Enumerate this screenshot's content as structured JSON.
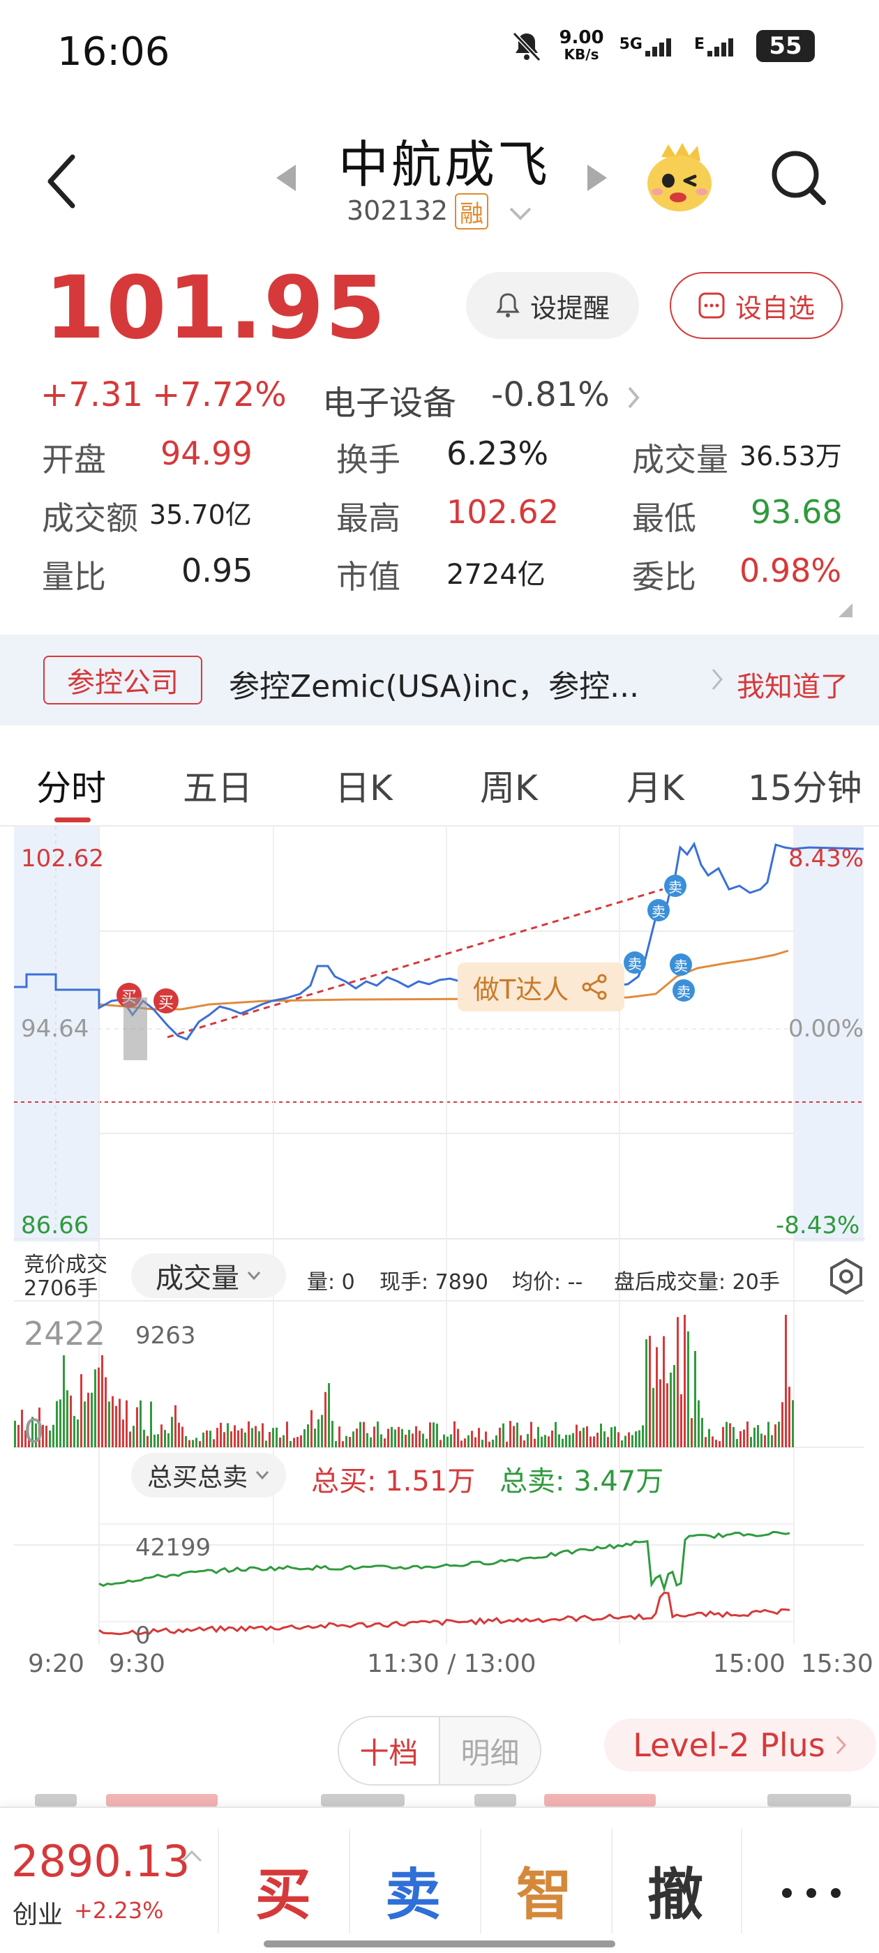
{
  "status_bar": {
    "time": "16:06",
    "speed_value": "9.00",
    "speed_unit": "KB/s",
    "net1": "5G",
    "net2": "E",
    "battery": "55"
  },
  "header": {
    "name": "中航成飞",
    "code": "302132",
    "badge": "融"
  },
  "quote": {
    "price": "101.95",
    "change": "+7.31",
    "change_pct": "+7.72%",
    "sector": "电子设备",
    "sector_pct": "-0.81%",
    "set_alert": "设提醒",
    "add_watch": "设自选"
  },
  "stats": [
    [
      {
        "label": "开盘",
        "value": "94.99",
        "color": "red"
      },
      {
        "label": "换手",
        "value": "6.23%",
        "color": "dark"
      },
      {
        "label": "成交量",
        "value": "36.53万",
        "color": "dark"
      }
    ],
    [
      {
        "label": "成交额",
        "value": "35.70亿",
        "color": "dark"
      },
      {
        "label": "最高",
        "value": "102.62",
        "color": "red"
      },
      {
        "label": "最低",
        "value": "93.68",
        "color": "green"
      }
    ],
    [
      {
        "label": "量比",
        "value": "0.95",
        "color": "dark"
      },
      {
        "label": "市值",
        "value": "2724亿",
        "color": "dark"
      },
      {
        "label": "委比",
        "value": "0.98%",
        "color": "red"
      }
    ]
  ],
  "banner": {
    "tag": "参控公司",
    "text": "参控Zemic(USA)inc，参控...",
    "dismiss": "我知道了"
  },
  "tabs": [
    "分时",
    "五日",
    "日K",
    "周K",
    "月K",
    "15分钟"
  ],
  "intraday": {
    "top_price": "102.62",
    "mid_price": "94.64",
    "bottom_price": "86.66",
    "top_pct": "8.43%",
    "mid_pct": "0.00%",
    "bottom_pct": "-8.43%",
    "buy_mark": "买",
    "sell_mark": "卖",
    "promo": "做T达人",
    "auction_label": "竞价成交",
    "auction_volume": "2706手",
    "volume_selector": "成交量",
    "vol_now": "量: 0",
    "hand_now": "现手: 7890",
    "avg_price": "均价: --",
    "after_volume": "盘后成交量: 20手",
    "vol_left_max": "2422",
    "vol_left_zero": "0",
    "vol_max": "9263",
    "total_selector": "总买总卖",
    "total_buy": "总买: 1.51万",
    "total_sell": "总卖: 3.47万",
    "total_max": "42199",
    "total_zero": "0",
    "times": [
      "9:20",
      "9:30",
      "11:30 / 13:00",
      "15:00",
      "15:30"
    ]
  },
  "orderbook": {
    "tab_active": "十档",
    "tab_other": "明细",
    "level2": "Level-2 Plus"
  },
  "bottom_bar": {
    "index_value": "2890.13",
    "index_name": "创业",
    "index_pct": "+2.23%",
    "buy": "买",
    "sell": "卖",
    "smart": "智",
    "cancel": "撤"
  },
  "colors": {
    "up": "#d6393a",
    "down": "#2f9a3d",
    "price_line": "#3a6fd8",
    "avg_line": "#e08b3a",
    "accent_orange": "#d4883a"
  }
}
